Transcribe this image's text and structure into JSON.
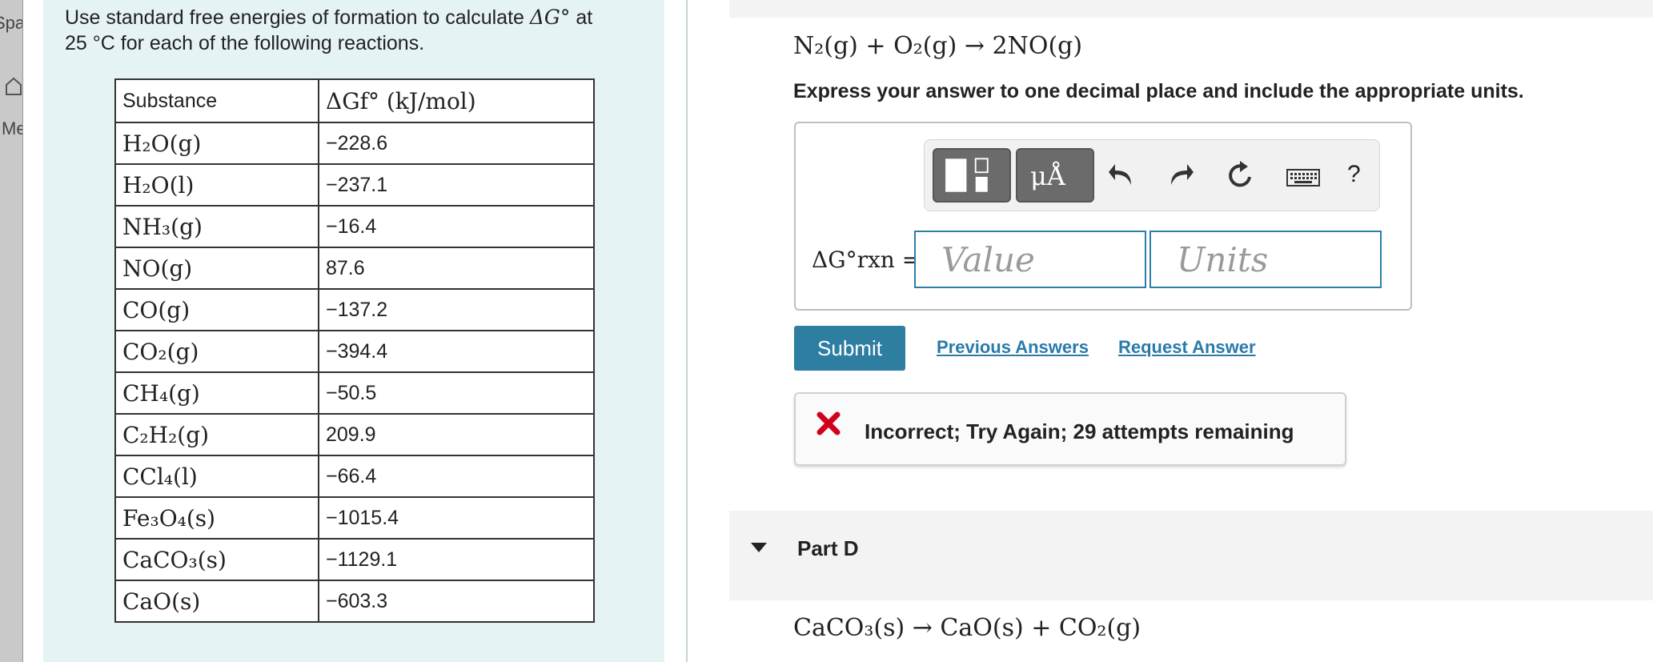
{
  "sidebar": {
    "fragment_top": "Spa",
    "fragment_mid": "Me"
  },
  "intro": {
    "line1_a": "Use standard free energies of formation to calculate ",
    "line1_math": "ΔG°",
    "line1_b": " at",
    "line2": "25 °C for each of the following reactions."
  },
  "table": {
    "header_substance": "Substance",
    "header_value": "ΔGf° (kJ/mol)",
    "rows": [
      {
        "substance": "H₂O(g)",
        "value": "−228.6"
      },
      {
        "substance": "H₂O(l)",
        "value": "−237.1"
      },
      {
        "substance": "NH₃(g)",
        "value": "−16.4"
      },
      {
        "substance": "NO(g)",
        "value": "87.6"
      },
      {
        "substance": "CO(g)",
        "value": "−137.2"
      },
      {
        "substance": "CO₂(g)",
        "value": "−394.4"
      },
      {
        "substance": "CH₄(g)",
        "value": "−50.5"
      },
      {
        "substance": "C₂H₂(g)",
        "value": "209.9"
      },
      {
        "substance": "CCl₄(l)",
        "value": "−66.4"
      },
      {
        "substance": "Fe₃O₄(s)",
        "value": "−1015.4"
      },
      {
        "substance": "CaCO₃(s)",
        "value": "−1129.1"
      },
      {
        "substance": "CaO(s)",
        "value": "−603.3"
      }
    ]
  },
  "part_c": {
    "reaction": "N₂(g) + O₂(g) → 2NO(g)",
    "instruction": "Express your answer to one decimal place and include the appropriate units.",
    "toolbar": {
      "units_button": "μÅ",
      "help": "?"
    },
    "answer_label": "ΔG°rxn =",
    "value_placeholder": "Value",
    "units_placeholder": "Units",
    "submit": "Submit",
    "previous_answers": "Previous Answers",
    "request_answer": "Request Answer",
    "feedback": "Incorrect; Try Again; 29 attempts remaining"
  },
  "part_d": {
    "title": "Part D",
    "reaction": "CaCO₃(s) → CaO(s) + CO₂(g)"
  },
  "colors": {
    "panel_bg": "#e6f3f4",
    "accent": "#2e7ea2",
    "link": "#2b7aa8",
    "error": "#d0021b"
  }
}
